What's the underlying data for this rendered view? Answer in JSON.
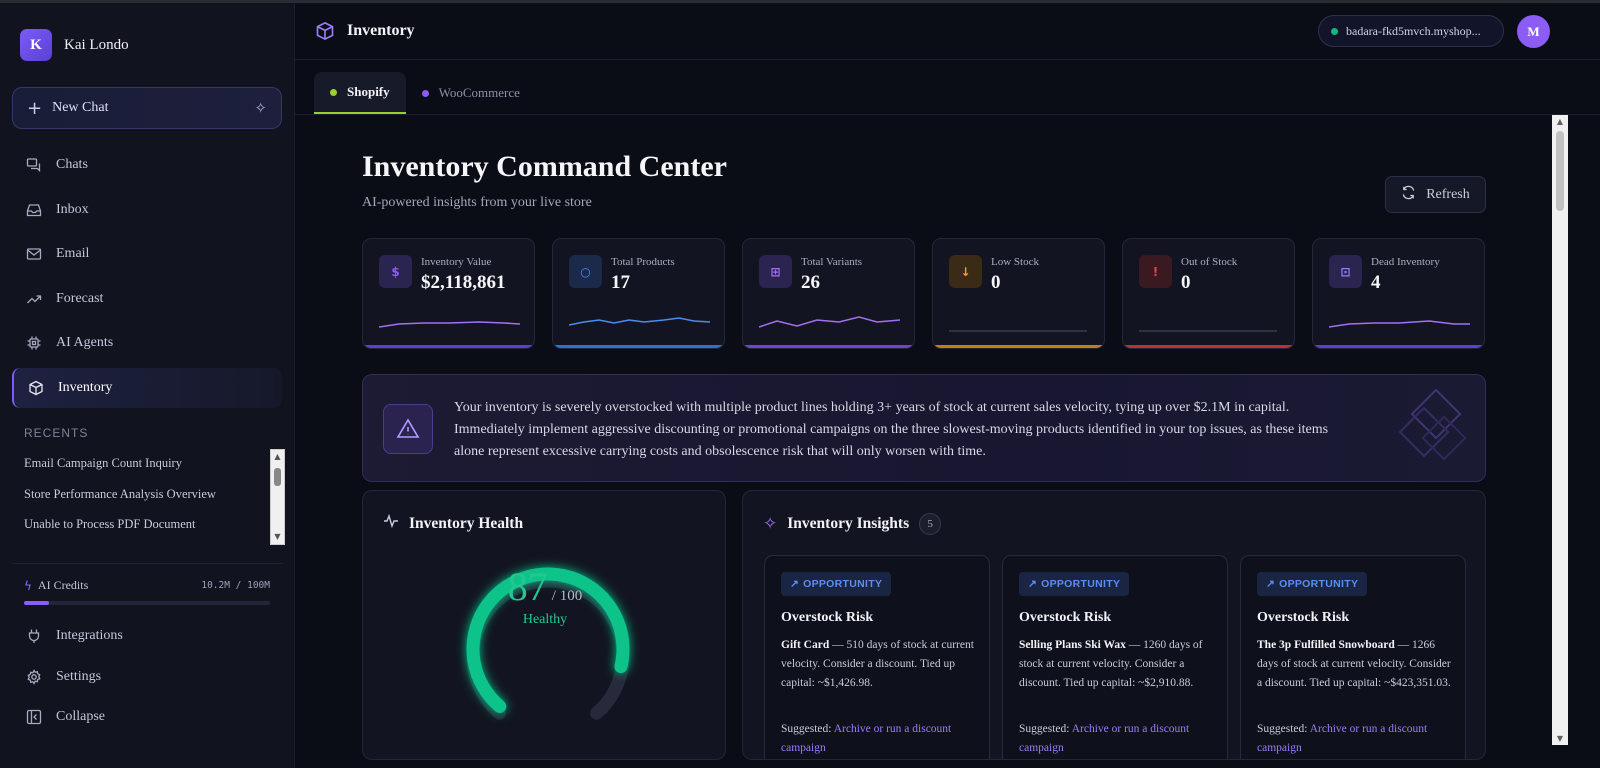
{
  "sidebar": {
    "profile_initial": "K",
    "profile_name": "Kai Londo",
    "new_chat_label": "New Chat",
    "nav": [
      {
        "label": "Chats",
        "icon": "chat-bubbles-icon"
      },
      {
        "label": "Inbox",
        "icon": "inbox-icon"
      },
      {
        "label": "Email",
        "icon": "mail-icon"
      },
      {
        "label": "Forecast",
        "icon": "trend-up-icon"
      },
      {
        "label": "AI Agents",
        "icon": "cpu-icon"
      },
      {
        "label": "Inventory",
        "icon": "box-icon",
        "active": true
      }
    ],
    "recents_title": "RECENTS",
    "recents": [
      "Email Campaign Count Inquiry",
      "Store Performance Analysis Overview",
      "Unable to Process PDF Document"
    ],
    "credits_label": "AI Credits",
    "credits_value": "10.2M / 100M",
    "credits_fraction": 0.102,
    "bottom_nav": [
      {
        "label": "Integrations",
        "icon": "plug-icon"
      },
      {
        "label": "Settings",
        "icon": "gear-icon"
      },
      {
        "label": "Collapse",
        "icon": "collapse-icon"
      }
    ]
  },
  "header": {
    "title": "Inventory",
    "store": "badara-fkd5mvch.myshop...",
    "user_initial": "M"
  },
  "tabs": [
    {
      "label": "Shopify",
      "dot_color": "#9acd32",
      "active": true
    },
    {
      "label": "WooCommerce",
      "dot_color": "#8b5cf6",
      "active": false
    }
  ],
  "main": {
    "title": "Inventory Command Center",
    "subtitle": "AI-powered insights from your live store",
    "refresh_label": "Refresh"
  },
  "stats": [
    {
      "label": "Inventory Value",
      "value": "$2,118,861",
      "glyph": "$",
      "color": "#8b5cf6",
      "icon_bg": "#2a2450",
      "bottom": "#5b3fd6"
    },
    {
      "label": "Total Products",
      "value": "17",
      "glyph": "○",
      "color": "#4a8cf0",
      "icon_bg": "#1b2a4a",
      "bottom": "#2f6fd8"
    },
    {
      "label": "Total Variants",
      "value": "26",
      "glyph": "⊞",
      "color": "#a270f5",
      "icon_bg": "#2b2350",
      "bottom": "#6b46d6"
    },
    {
      "label": "Low Stock",
      "value": "0",
      "glyph": "↓",
      "color": "#f0a020",
      "icon_bg": "#3a2a16",
      "bottom": "#c08016"
    },
    {
      "label": "Out of Stock",
      "value": "0",
      "glyph": "!",
      "color": "#e04848",
      "icon_bg": "#3a1a20",
      "bottom": "#b83434"
    },
    {
      "label": "Dead Inventory",
      "value": "4",
      "glyph": "⊡",
      "color": "#9a7cf8",
      "icon_bg": "#2a2450",
      "bottom": "#5b3fd6"
    }
  ],
  "alert": {
    "text": "Your inventory is severely overstocked with multiple product lines holding 3+ years of stock at current sales velocity, tying up over $2.1M in capital. Immediately implement aggressive discounting or promotional campaigns on the three slowest-moving products identified in your top issues, as these items alone represent excessive carrying costs and obsolescence risk that will only worsen with time."
  },
  "health": {
    "title": "Inventory Health",
    "score": "87",
    "out_of": "/ 100",
    "score_fraction": 0.87,
    "status": "Healthy"
  },
  "insights": {
    "title": "Inventory Insights",
    "count": "5",
    "items": [
      {
        "badge": "OPPORTUNITY",
        "title": "Overstock Risk",
        "product": "Gift Card",
        "body": " — 510 days of stock at current velocity. Consider a discount. Tied up capital: ~$1,426.98.",
        "suggest_label": "Suggested:",
        "suggest_link": "Archive or run a discount campaign"
      },
      {
        "badge": "OPPORTUNITY",
        "title": "Overstock Risk",
        "product": "Selling Plans Ski Wax",
        "body": " — 1260 days of stock at current velocity. Consider a discount. Tied up capital: ~$2,910.88.",
        "suggest_label": "Suggested:",
        "suggest_link": "Archive or run a discount campaign"
      },
      {
        "badge": "OPPORTUNITY",
        "title": "Overstock Risk",
        "product": "The 3p Fulfilled Snowboard",
        "body": " — 1266 days of stock at current velocity. Consider a discount. Tied up capital: ~$423,351.03.",
        "suggest_label": "Suggested:",
        "suggest_link": "Archive or run a discount campaign"
      }
    ]
  }
}
